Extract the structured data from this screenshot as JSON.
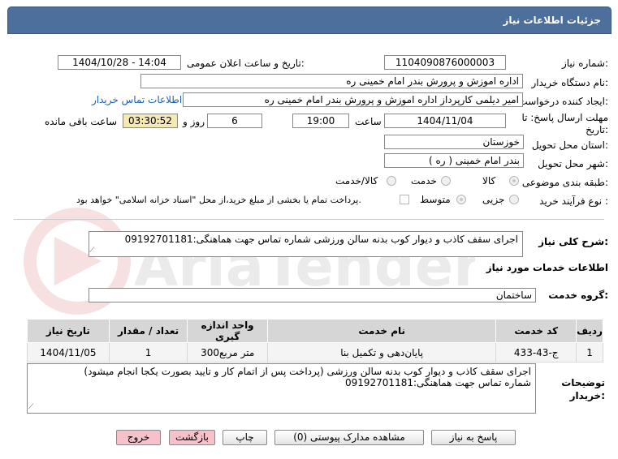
{
  "header": {
    "title": "جزئیات اطلاعات نیاز"
  },
  "fields": {
    "need_number_label": "شماره نیاز:",
    "need_number": "1104090876000003",
    "announce_label": "تاریخ و ساعت اعلان عمومی:",
    "announce_value": "1404/10/28 - 14:04",
    "buyer_label": "نام دستگاه خریدار:",
    "buyer_value": "اداره اموزش و پرورش بندر امام خمینی  ره",
    "creator_label": "ایجاد کننده درخواست:",
    "creator_value": "امیر دیلمی کارپرداز اداره اموزش و پرورش بندر امام خمینی  ره",
    "contact_link": "اطلاعات تماس خریدار",
    "deadline_label_1": "مهلت ارسال پاسخ: تا",
    "deadline_label_2": "تاریخ:",
    "deadline_date": "1404/11/04",
    "time_label": "ساعت",
    "deadline_time": "19:00",
    "days_value": "6",
    "days_label": "روز و",
    "remaining_value": "03:30:52",
    "remaining_label": "ساعت باقی مانده",
    "province_label": "استان محل تحویل:",
    "province_value": "خوزستان",
    "city_label": "شهر محل تحویل:",
    "city_value": "بندر امام خمینی ( ره )",
    "category_label": "طبقه بندی موضوعی:",
    "category_options": [
      "کالا",
      "خدمت",
      "کالا/خدمت"
    ],
    "process_label": "نوع فرآیند خرید :",
    "process_options": [
      "جزیی",
      "متوسط"
    ],
    "payment_note": "پرداخت تمام یا بخشی از مبلغ خرید،از محل \"اسناد خزانه اسلامی\" خواهد بود."
  },
  "description": {
    "label": "شرح کلی نیاز:",
    "text": "اجرای سقف کاذب و دیوار کوب بدنه سالن ورزشی شماره تماس جهت هماهنگی:09192701181"
  },
  "services": {
    "section_title": "اطلاعات خدمات مورد نیاز",
    "group_label": "گروه خدمت:",
    "group_value": "ساختمان",
    "columns": [
      "ردیف",
      "کد خدمت",
      "نام خدمت",
      "واحد اندازه گیری",
      "تعداد / مقدار",
      "تاریخ نیاز"
    ],
    "rows": [
      {
        "row": "1",
        "code": "ج-43-433",
        "name": "پایان‌دهی و تکمیل بنا",
        "unit": "300متر مربع",
        "qty": "1",
        "date": "1404/11/05"
      }
    ]
  },
  "buyer_notes": {
    "label_1": "توضیحات",
    "label_2": "خریدار:",
    "line1": "اجرای سقف کاذب و دیوار کوب بدنه سالن ورزشی (پرداخت پس از اتمام کار و تایید بصورت یکجا انجام میشود)",
    "line2": "شماره تماس جهت هماهنگی:09192701181"
  },
  "buttons": {
    "reply": "پاسخ به نیاز",
    "view_docs": "مشاهده مدارک پیوستی (0)",
    "print": "چاپ",
    "back": "بازگشت",
    "exit": "خروج"
  },
  "watermark": {
    "text": "AriaTender.neT"
  },
  "colors": {
    "header": "#4d6f9b",
    "remaining_bg": "#f4e9b5",
    "link": "#1a5fb4",
    "button_pink": "#f7c1c9"
  }
}
